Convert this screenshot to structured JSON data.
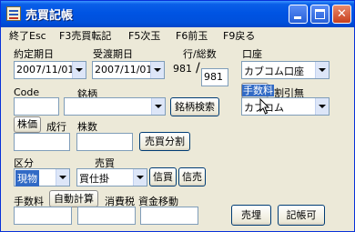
{
  "window": {
    "title": "売買記帳"
  },
  "menu": [
    {
      "label": "終了Esc"
    },
    {
      "label": "F3売買転記"
    },
    {
      "label": "F5次玉"
    },
    {
      "label": "F6前玉"
    },
    {
      "label": "F9戻る"
    }
  ],
  "form": {
    "contract_date": {
      "label": "約定期日",
      "value": "2007/11/01"
    },
    "delivery_date": {
      "label": "受渡期日",
      "value": "2007/11/01"
    },
    "line_total": {
      "label": "行/総数",
      "current": "981",
      "separator": "/",
      "total": "981"
    },
    "account": {
      "label": "口座",
      "value": "カブコム口座"
    },
    "code": {
      "label": "Code",
      "value": ""
    },
    "stock_name": {
      "label": "銘柄",
      "value": ""
    },
    "stock_search_button": {
      "label": "銘柄検索"
    },
    "fee_button": {
      "label": "手数料"
    },
    "discount": {
      "label": "割引無"
    },
    "broker": {
      "value": "カブコム"
    },
    "price_mode": {
      "label_price": "株価",
      "label_executed": "成行"
    },
    "quantity": {
      "label": "株数"
    },
    "split_button": {
      "label": "売買分割"
    },
    "division": {
      "label": "区分",
      "value": "現物"
    },
    "trade": {
      "label": "売買",
      "value": "買仕掛"
    },
    "credit_buy_button": {
      "label": "信買"
    },
    "credit_sell_button": {
      "label": "信売"
    },
    "commission": {
      "label": "手数料"
    },
    "auto_calc_button": {
      "label": "自動計算"
    },
    "consumption_tax": {
      "label": "消費税"
    },
    "fund_transfer": {
      "label": "資金移動"
    },
    "trade_button": {
      "label": "売埋"
    },
    "record_button": {
      "label": "記帳可"
    }
  }
}
